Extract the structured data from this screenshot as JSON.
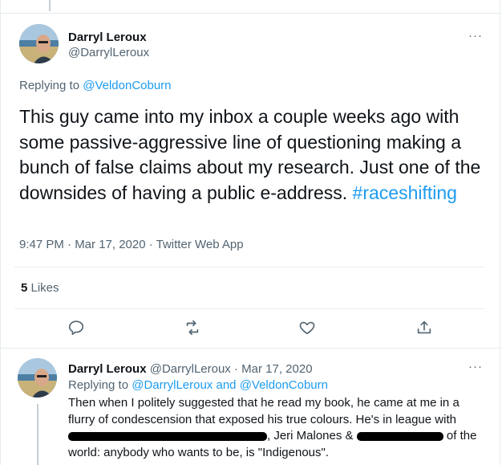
{
  "tweet": {
    "author_name": "Darryl Leroux",
    "author_handle": "@DarrylLeroux",
    "more_glyph": "···",
    "replying_prefix": "Replying to ",
    "replying_to": "@VeldonCoburn",
    "text": "This guy came into my inbox a couple weeks ago with some passive-aggressive line of questioning making a bunch of false claims about my research. Just one of the downsides of having a public e-address. ",
    "hashtag": "#raceshifting",
    "meta": "9:47 PM · Mar 17, 2020 · Twitter Web App",
    "likes_count": "5",
    "likes_label": " Likes"
  },
  "actions": {
    "reply": "reply-icon",
    "retweet": "retweet-icon",
    "like": "heart-icon",
    "share": "share-icon"
  },
  "reply": {
    "author_name": "Darryl Leroux",
    "author_handle": "@DarrylLeroux",
    "date": " · Mar 17, 2020",
    "more_glyph": "···",
    "replying_prefix": "Replying to ",
    "replying_to_1": "@DarrylLeroux",
    "and": " and ",
    "replying_to_2": "@VeldonCoburn",
    "text_part1": "Then when I politely suggested that he read my book, he came at me in a flurry of condescension that exposed his true colours. He's in league with ",
    "text_part2": ", Jeri Malones & ",
    "text_part3": " of the world: anybody who wants to be, is \"Indigenous\"."
  },
  "colors": {
    "link": "#1d9bf0",
    "text": "#0f1419",
    "secondary": "#536471",
    "border": "#e6ecf0"
  }
}
